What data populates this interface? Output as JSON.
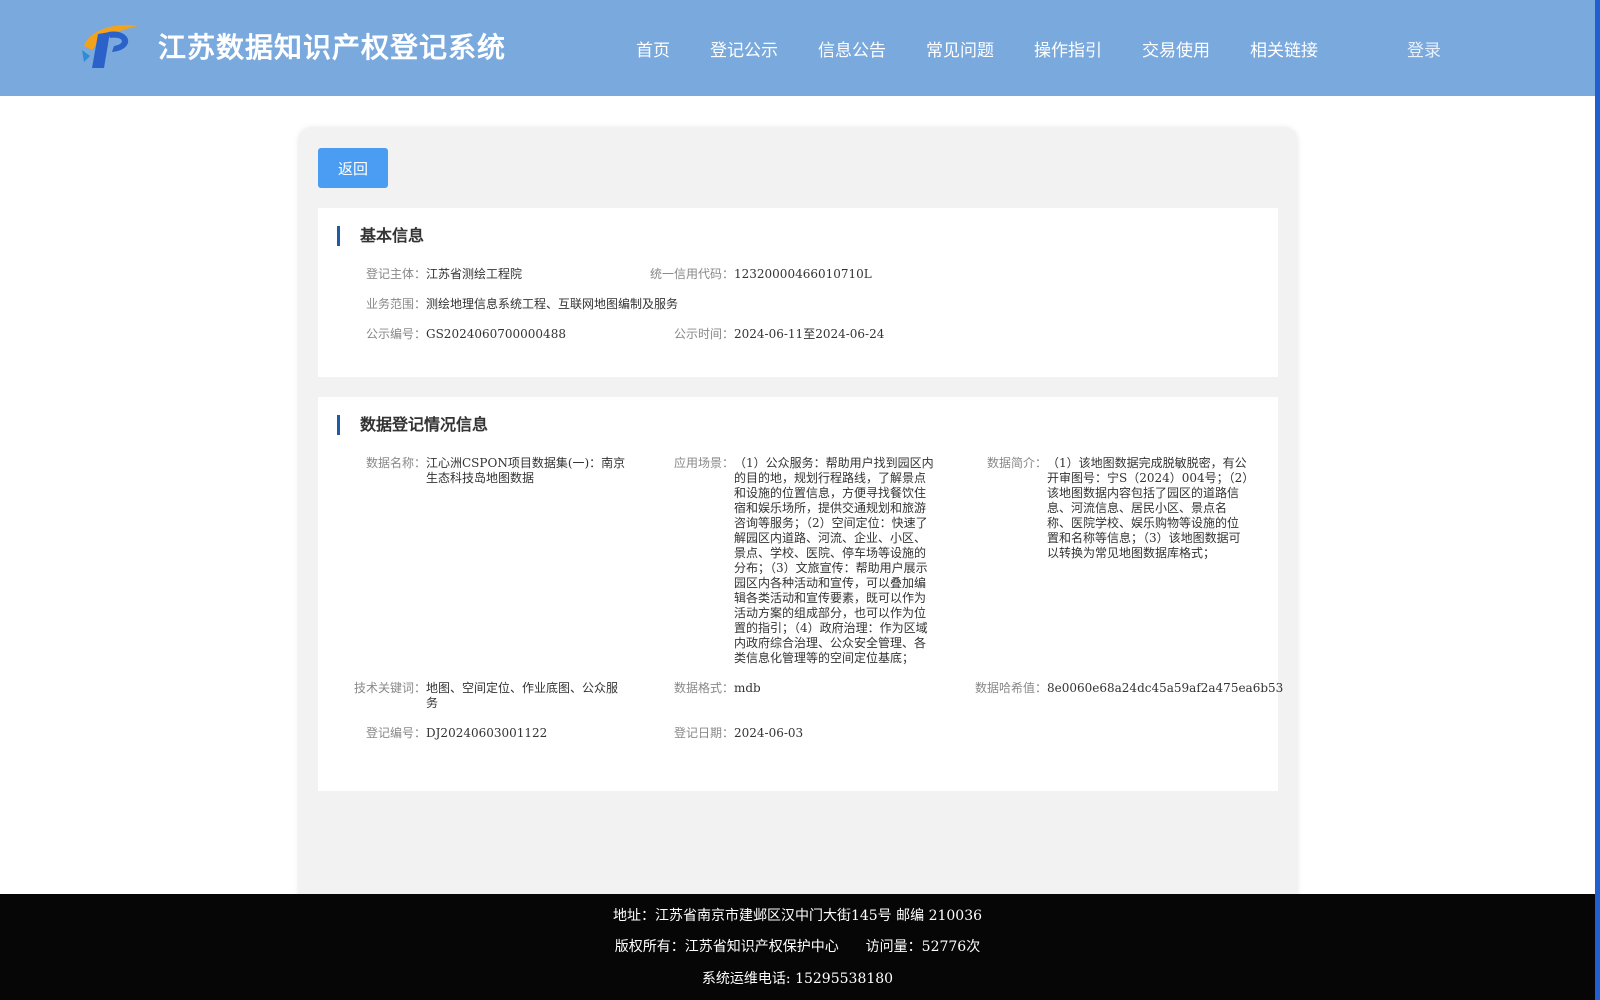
{
  "header": {
    "title": "江苏数据知识产权登记系统",
    "nav": [
      "首页",
      "登记公示",
      "信息公告",
      "常见问题",
      "操作指引",
      "交易使用",
      "相关链接"
    ],
    "login": "登录"
  },
  "back_button": "返回",
  "basic_info": {
    "title": "基本信息",
    "subject_label": "登记主体：",
    "subject": "江苏省测绘工程院",
    "credit_code_label": "统一信用代码：",
    "credit_code": "12320000466010710L",
    "scope_label": "业务范围：",
    "scope": "测绘地理信息系统工程、互联网地图编制及服务",
    "notice_no_label": "公示编号：",
    "notice_no": "GS2024060700000488",
    "notice_time_label": "公示时间：",
    "notice_time": "2024-06-11至2024-06-24"
  },
  "data_info": {
    "title": "数据登记情况信息",
    "name_label": "数据名称：",
    "name": "江心洲CSPON项目数据集(一)：南京生态科技岛地图数据",
    "scene_label": "应用场景：",
    "scene": "（1）公众服务：帮助用户找到园区内的目的地，规划行程路线，了解景点和设施的位置信息，方便寻找餐饮住宿和娱乐场所，提供交通规划和旅游咨询等服务；（2）空间定位：快速了解园区内道路、河流、企业、小区、景点、学校、医院、停车场等设施的分布；（3）文旅宣传：帮助用户展示园区内各种活动和宣传，可以叠加编辑各类活动和宣传要素，既可以作为活动方案的组成部分，也可以作为位置的指引；（4）政府治理：作为区域内政府综合治理、公众安全管理、各类信息化管理等的空间定位基底；",
    "intro_label": "数据简介：",
    "intro": "（1）该地图数据完成脱敏脱密，有公开审图号：宁S（2024）004号；（2）该地图数据内容包括了园区的道路信息、河流信息、居民小区、景点名称、医院学校、娱乐购物等设施的位置和名称等信息；（3）该地图数据可以转换为常见地图数据库格式；",
    "keywords_label": "技术关键词：",
    "keywords": "地图、空间定位、作业底图、公众服务",
    "format_label": "数据格式：",
    "format": "mdb",
    "hash_label": "数据哈希值：",
    "hash": "8e0060e68a24dc45a59af2a475ea6b53",
    "reg_no_label": "登记编号：",
    "reg_no": "DJ20240603001122",
    "reg_date_label": "登记日期：",
    "reg_date": "2024-06-03"
  },
  "footer": {
    "address": "地址：江苏省南京市建邺区汉中门大街145号 邮编 210036",
    "copyright": "版权所有：江苏省知识产权保护中心",
    "visits": "访问量：52776次",
    "phone": "系统运维电话: 15295538180"
  }
}
